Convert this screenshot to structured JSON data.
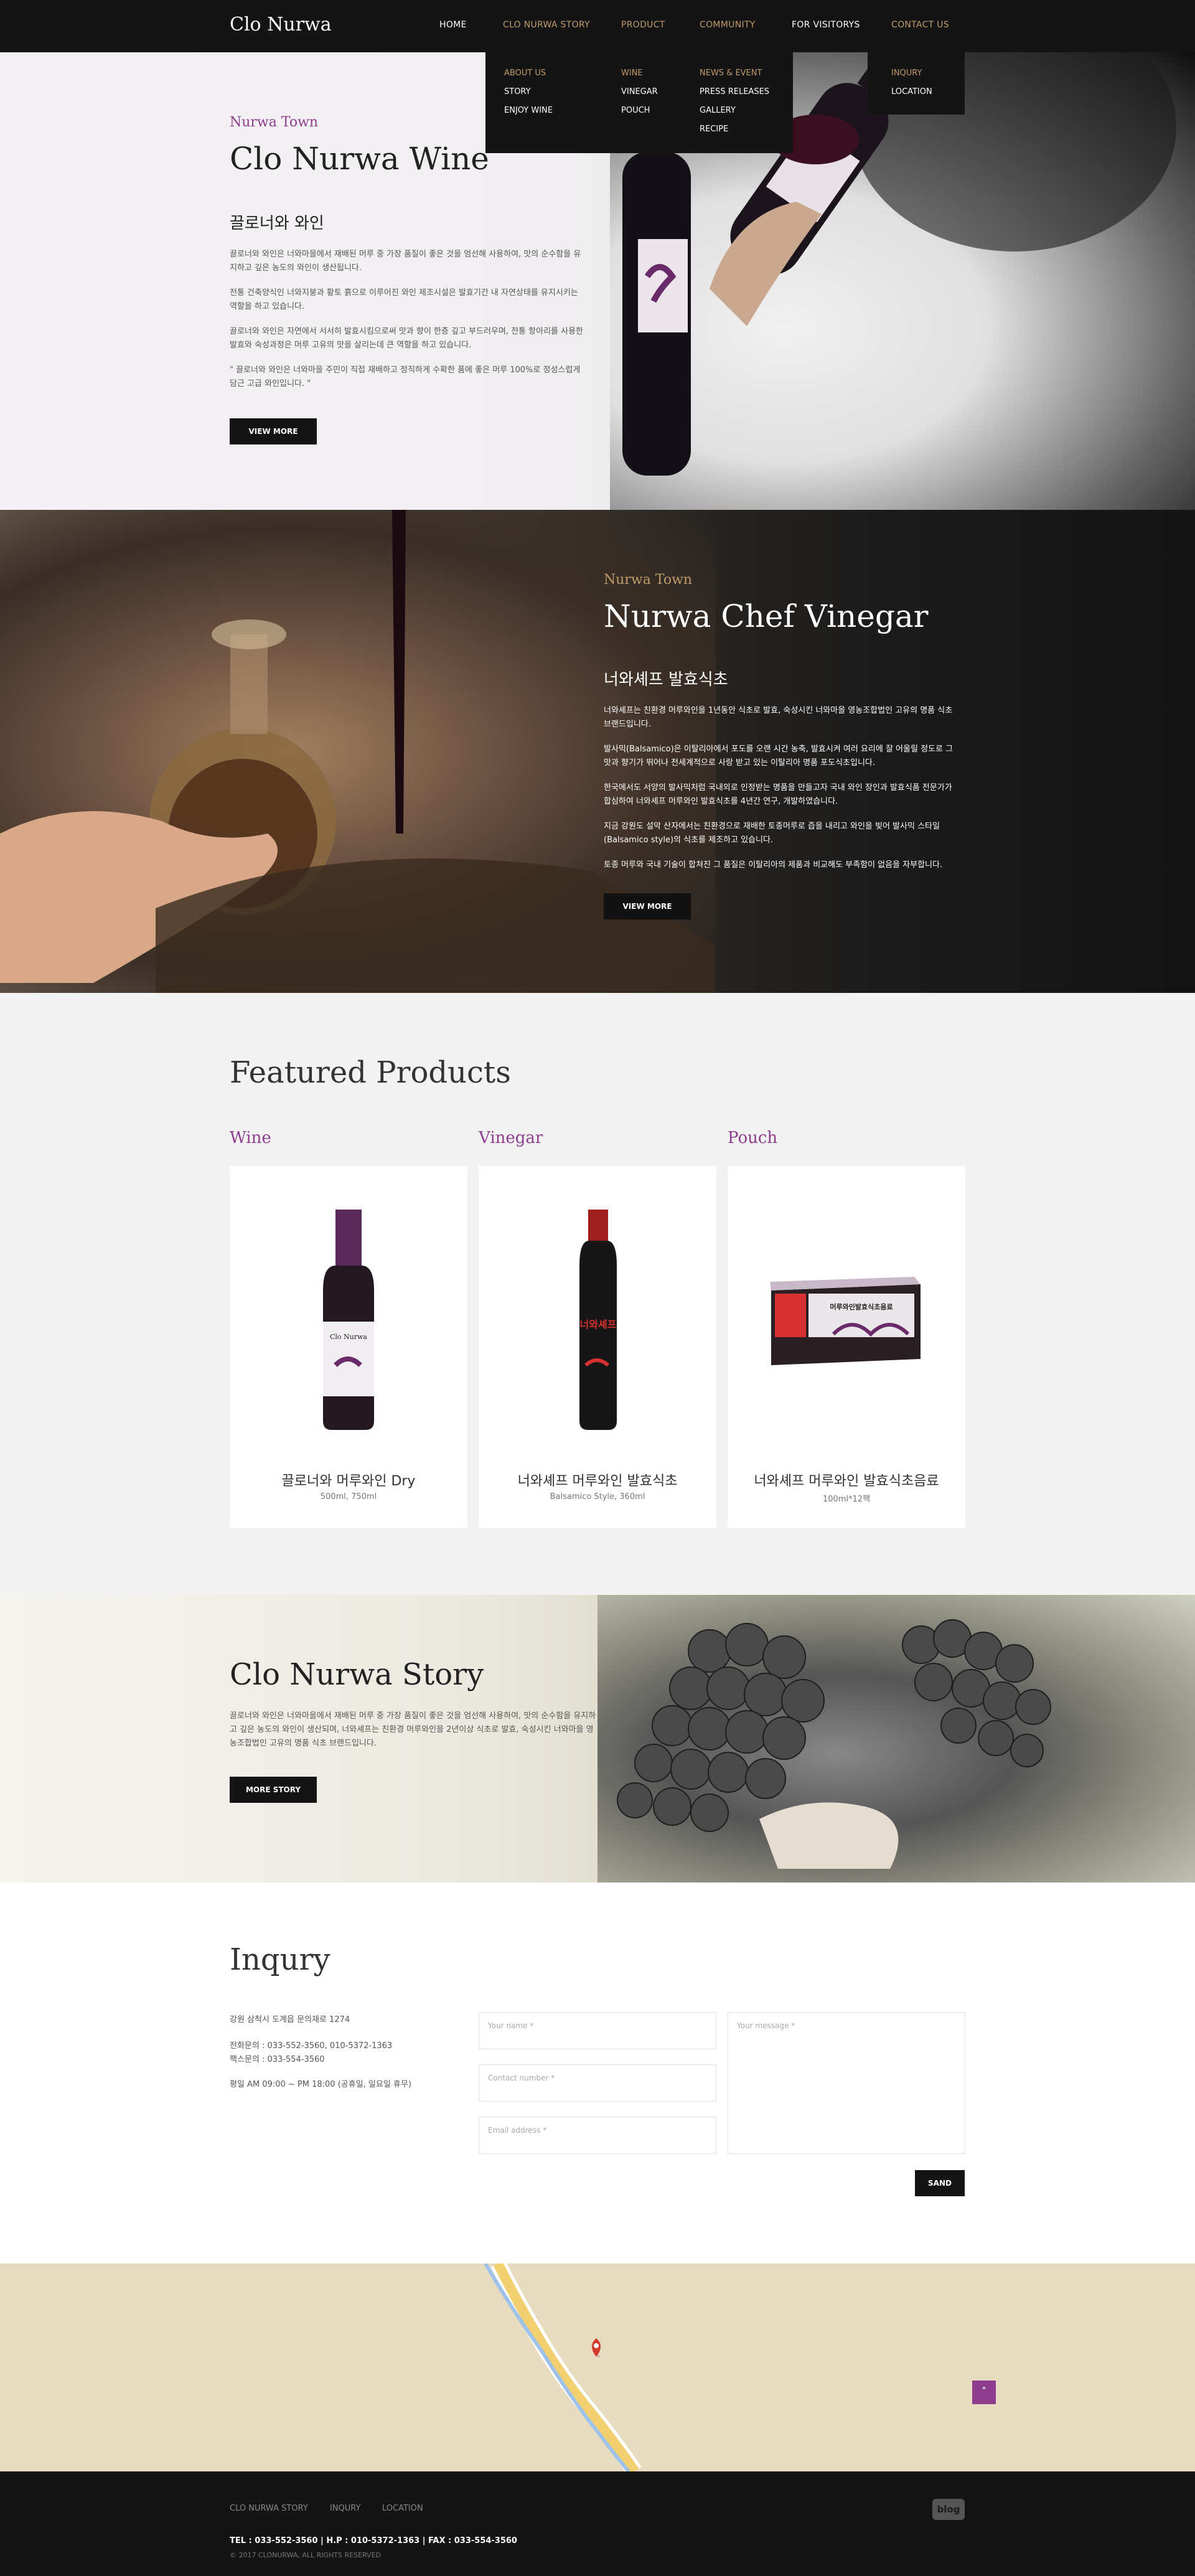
{
  "header": {
    "logo": "Clo Nurwa",
    "nav": [
      "HOME",
      "CLO NURWA STORY",
      "PRODUCT",
      "COMMUNITY",
      "FOR VISITORYS",
      "CONTACT US"
    ]
  },
  "dropdown": {
    "story": [
      "ABOUT US",
      "STORY",
      "ENJOY WINE"
    ],
    "product": [
      "WINE",
      "VINEGAR",
      "POUCH"
    ],
    "community": [
      "NEWS & EVENT",
      "PRESS RELEASES",
      "GALLERY",
      "RECIPE"
    ],
    "contact": [
      "INQURY",
      "LOCATION"
    ]
  },
  "hero": {
    "subtitle": "Nurwa Town",
    "title": "Clo Nurwa Wine",
    "kr_title": "끌로너와 와인",
    "p1": "끌로너와 와인은 너와마을에서 재배된 머루 중 가장 품질이 좋은 것을 엄선해 사용하여, 맛의 순수함을 유지하고 깊은 농도의 와인이 생산됩니다.",
    "p2": "전통 건축양식인 너와지붕과 황토 흙으로 이루어진 와인 제조시설은 발효기간 내 자연상태를 유지시키는 역할을 하고 있습니다.",
    "p3": "끌로너와 와인은 자연에서 서서히 발효시킴으로써 맛과 향이 한층 깊고 부드러우며, 전통 항아리를 사용한 발효와 숙성과정은 머루 고유의 맛을 살리는데 큰 역할을 하고 있습니다.",
    "p4": "\" 끌로너와 와인은 너와마을 주민이 직접 재배하고 정직하게 수확한 품에 좋은 머루 100%로 정성스럽게 담근 고급 와인입니다. \"",
    "button": "VIEW MORE"
  },
  "vinegar": {
    "subtitle": "Nurwa Town",
    "title": "Nurwa Chef Vinegar",
    "kr_title": "너와셰프 발효식초",
    "p1": "너와셰프는 친환경 머루와인을 1년동안 식초로 발효, 숙성시킨 너와마을 영농조합법인 고유의 명품 식초 브랜드입니다.",
    "p2": "발사믹(Balsamico)은 이탈리아에서 포도를 오랜 시간 농축, 발효시켜 여러 요리에 잘 어울릴 정도로 그 맛과 향기가 뛰어나 전세계적으로 사랑 받고 있는 이탈리아 명품 포도식초입니다.",
    "p3": "한국에서도 서양의 발사믹처럼 국내외로 인정받는 명품을 만들고자 국내 와인 장인과 발효식품 전문가가 합심하여 너와셰프 머루와인 발효식초를 4년간 연구, 개발하였습니다.",
    "p4": "지금 강원도 설악 산자에서는 친환경으로 재배한 토종머루로 즙을 내리고 와인을 빚어 발사믹 스타일(Balsamico style)의 식초를 제조하고 있습니다.",
    "p5": "토종 머루와 국내 기술이 합쳐진 그 품질은 이탈리아의 제품과 비교해도 부족함이 없음을 자부합니다.",
    "button": "VIEW MORE"
  },
  "products": {
    "title": "Featured Products",
    "items": [
      {
        "category": "Wine",
        "name": "끌로너와 머루와인 Dry",
        "desc": "500ml, 750ml",
        "label": "Clo Nurwa"
      },
      {
        "category": "Vinegar",
        "name": "너와셰프 머루와인 발효식초",
        "desc": "Balsamico Style, 360ml",
        "label": "너와셰프"
      },
      {
        "category": "Pouch",
        "name": "너와셰프 머루와인 발효식초음료",
        "desc": "100ml*12팩",
        "label": "머루와인발효식초음료"
      }
    ]
  },
  "story": {
    "title": "Clo Nurwa Story",
    "text": "끌로너와 와인은 너와마을에서 재배된 머루 중 가장 품질이 좋은 것을 엄선해 사용하여, 맛의 순수함을 유지하고 깊은 농도의 와인이 생산되며, 너와셰프는 친환경 머루와인을 2년이상 식초로 발효, 숙성시킨 너와마을 영농조합법인 고유의 명품 식초 브랜드입니다.",
    "button": "MORE STORY"
  },
  "inqury": {
    "title": "Inqury",
    "address": "강원 삼척시 도계읍 문의재로 1274",
    "phone": "전화문의 : 033-552-3560, 010-5372-1363",
    "fax": "팩스문의 : 033-554-3560",
    "hours": "평일 AM 09:00 ~ PM 18:00 (공휴일, 일요일 휴무)",
    "name_ph": "Your name *",
    "contact_ph": "Contact number *",
    "email_ph": "Email address *",
    "message_ph": "Your message *",
    "send": "SAND"
  },
  "footer": {
    "links": [
      "CLO NURWA STORY",
      "INQURY",
      "LOCATION"
    ],
    "contact": "TEL : 033-552-3560  |  H.P : 010-5372-1363  |  FAX : 033-554-3560",
    "copyright": "© 2017 CLONURWA, ALL RIGHTS RESERVED",
    "blog": "blog"
  },
  "colors": {
    "accent": "#8e3c8e",
    "gold": "#c09a6b",
    "dark": "#141414"
  }
}
